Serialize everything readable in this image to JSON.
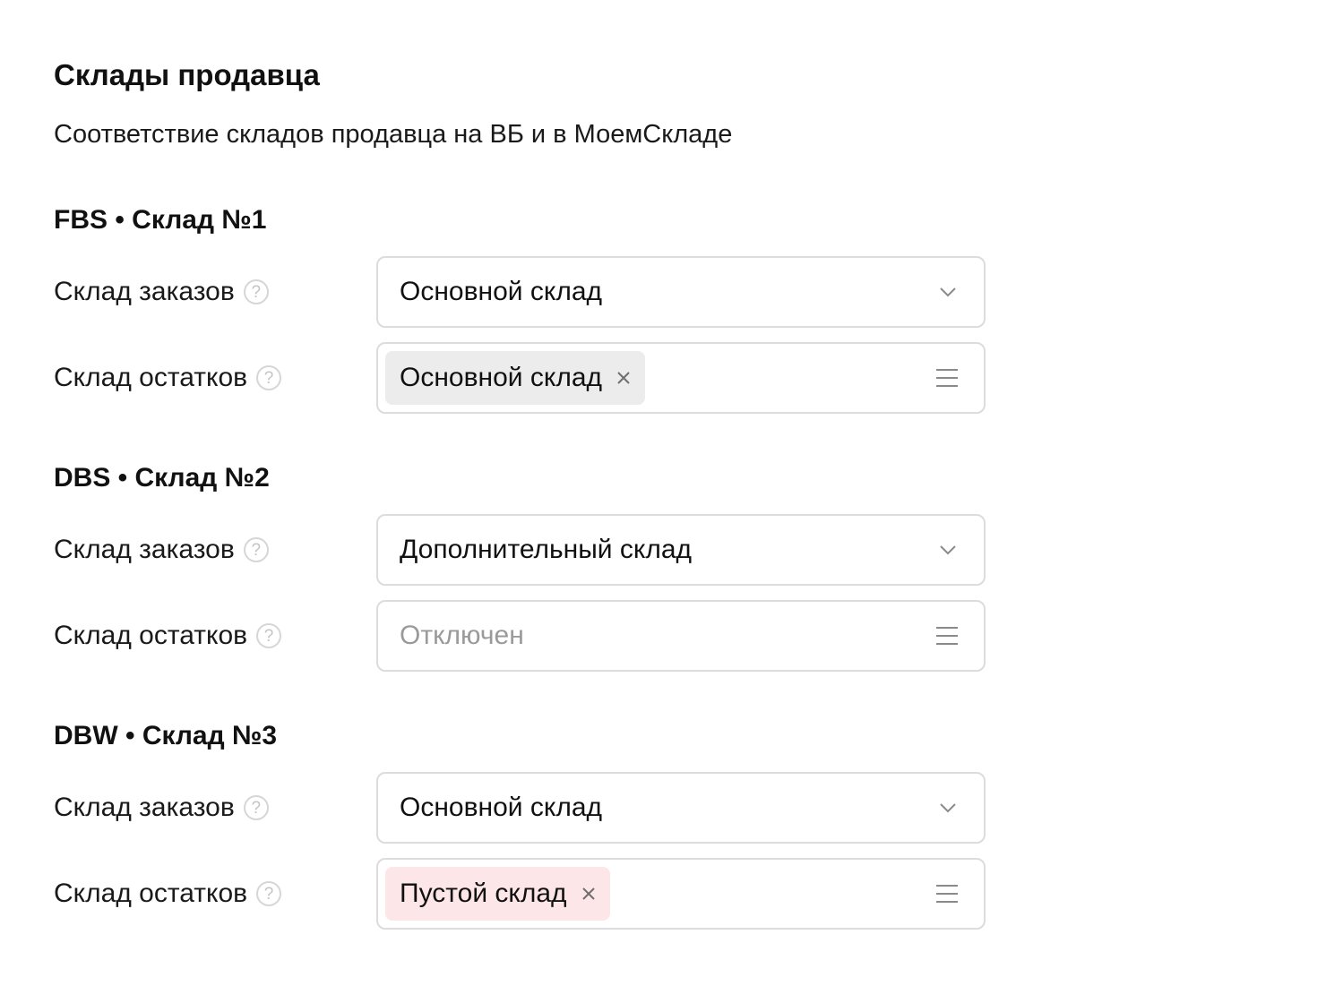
{
  "header": {
    "title": "Склады продавца",
    "subtitle": "Соответствие складов продавца на ВБ и в МоемСкладе"
  },
  "sections": [
    {
      "title": "FBS • Склад №1",
      "orders_label": "Склад заказов",
      "orders_value": "Основной склад",
      "stock_label": "Склад остатков",
      "stock_tag": "Основной склад"
    },
    {
      "title": "DBS • Склад №2",
      "orders_label": "Склад заказов",
      "orders_value": "Дополнительный склад",
      "stock_label": "Склад остатков",
      "stock_placeholder": "Отключен"
    },
    {
      "title": "DBW • Склад №3",
      "orders_label": "Склад заказов",
      "orders_value": "Основной склад",
      "stock_label": "Склад остатков",
      "stock_tag": "Пустой склад"
    }
  ],
  "icons": {
    "help": "question-circle-icon",
    "chevron": "chevron-down-icon",
    "menu": "list-menu-icon",
    "remove": "close-icon"
  },
  "colors": {
    "tag_neutral": "#ececec",
    "tag_danger": "#fde6e8",
    "border": "#dcdcdc",
    "placeholder": "#9a9a9a"
  }
}
